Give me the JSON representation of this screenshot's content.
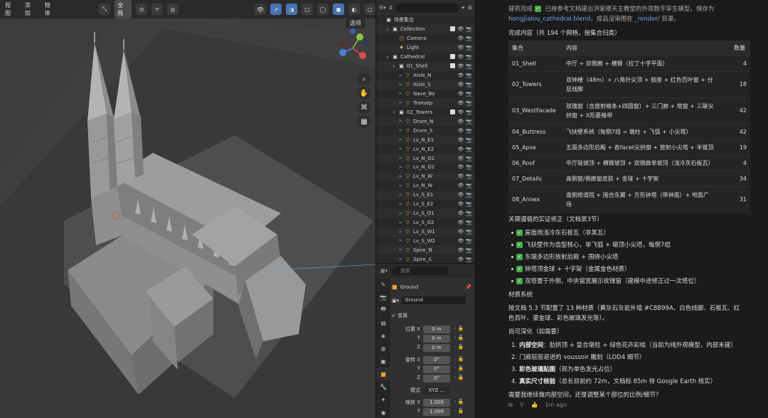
{
  "viewport": {
    "menu": [
      "视图",
      "添加",
      "物体"
    ],
    "transform_orientation": "全局",
    "selector_label": "选项"
  },
  "outliner": {
    "search_placeholder": "",
    "rows": [
      {
        "label": "场景集合",
        "indent": 0,
        "icon": "collection",
        "expand": "",
        "sel": false
      },
      {
        "label": "Collection",
        "indent": 1,
        "icon": "collection",
        "expand": "v",
        "sel": false
      },
      {
        "label": "Camera",
        "indent": 2,
        "icon": "camera",
        "expand": "",
        "sel": false
      },
      {
        "label": "Light",
        "indent": 2,
        "icon": "light",
        "expand": "",
        "sel": false
      },
      {
        "label": "Cathedral",
        "indent": 1,
        "icon": "collection",
        "expand": "v",
        "sel": false
      },
      {
        "label": "01_Shell",
        "indent": 2,
        "icon": "collection",
        "expand": "v",
        "sel": false
      },
      {
        "label": "Aisle_N",
        "indent": 3,
        "icon": "mesh",
        "expand": ">",
        "sel": false
      },
      {
        "label": "Aisle_S",
        "indent": 3,
        "icon": "mesh",
        "expand": ">",
        "sel": false
      },
      {
        "label": "Nave_Bo",
        "indent": 3,
        "icon": "mesh",
        "expand": ">",
        "sel": false
      },
      {
        "label": "Transep",
        "indent": 3,
        "icon": "mesh",
        "expand": ">",
        "sel": false
      },
      {
        "label": "02_Towers",
        "indent": 2,
        "icon": "collection",
        "expand": "v",
        "sel": false
      },
      {
        "label": "Drum_N",
        "indent": 3,
        "icon": "mesh",
        "expand": ">",
        "sel": false
      },
      {
        "label": "Drum_S",
        "indent": 3,
        "icon": "mesh",
        "expand": ">",
        "sel": false
      },
      {
        "label": "Lv_N_E1",
        "indent": 3,
        "icon": "mesh",
        "expand": ">",
        "sel": false
      },
      {
        "label": "Lv_N_E2",
        "indent": 3,
        "icon": "mesh",
        "expand": ">",
        "sel": false
      },
      {
        "label": "Lv_N_O1",
        "indent": 3,
        "icon": "mesh",
        "expand": ">",
        "sel": false
      },
      {
        "label": "Lv_N_O2",
        "indent": 3,
        "icon": "mesh",
        "expand": ">",
        "sel": false
      },
      {
        "label": "Lv_N_W",
        "indent": 3,
        "icon": "mesh",
        "expand": ">",
        "sel": false
      },
      {
        "label": "Lv_N_W",
        "indent": 3,
        "icon": "mesh",
        "expand": ">",
        "sel": false
      },
      {
        "label": "Lv_S_E1",
        "indent": 3,
        "icon": "mesh",
        "expand": ">",
        "sel": false
      },
      {
        "label": "Lv_S_E2",
        "indent": 3,
        "icon": "mesh",
        "expand": ">",
        "sel": false
      },
      {
        "label": "Lv_S_O1",
        "indent": 3,
        "icon": "mesh",
        "expand": ">",
        "sel": false
      },
      {
        "label": "Lv_S_O2",
        "indent": 3,
        "icon": "mesh",
        "expand": ">",
        "sel": false
      },
      {
        "label": "Lv_S_W1",
        "indent": 3,
        "icon": "mesh",
        "expand": ">",
        "sel": false
      },
      {
        "label": "Lv_S_W2",
        "indent": 3,
        "icon": "mesh",
        "expand": ">",
        "sel": false
      },
      {
        "label": "Spire_N",
        "indent": 3,
        "icon": "mesh",
        "expand": ">",
        "sel": false
      },
      {
        "label": "Spire_S",
        "indent": 3,
        "icon": "mesh",
        "expand": ">",
        "sel": false
      }
    ]
  },
  "properties": {
    "search_placeholder": "搜索",
    "object_name": "Ground",
    "mesh_name": "Ground",
    "section": "变换",
    "location_label": "位置 X",
    "location": {
      "x": "0 m",
      "y": "0 m",
      "z": "0 m"
    },
    "rotation_label": "旋转 X",
    "rotation": {
      "x": "0°",
      "y": "0°",
      "z": "0°"
    },
    "mode_label": "模式",
    "mode": "XYZ ...",
    "scale_label": "缩放 X",
    "scale": {
      "x": "1.000",
      "y": "1.000"
    },
    "axis": {
      "y": "Y",
      "z": "Z"
    }
  },
  "chat": {
    "intro_1": "建筑完成",
    "intro_2": "已按参考文档建出洪家楼天主教堂的外观数字孪生模型，保存为",
    "file": "hongjialou_cathedral.blend",
    "intro_3": "，成品渲染图在",
    "render_dir": "_render/",
    "intro_4": "目录。",
    "done_heading": "完成内容（共 194 个网格，按集合归类）",
    "table_headers": [
      "集合",
      "内容",
      "数量"
    ],
    "table_rows": [
      {
        "col": "01_Shell",
        "content": [
          "中厅 + 双侧廊 + 横臂（拉丁十字平面）"
        ],
        "count": "4"
      },
      {
        "col": "02_Towers",
        "content": [
          "双钟楼（48m）+ 八角针尖顶 + 鼓座 + 红色百叶窗 + 分",
          "层线脚"
        ],
        "count": "18"
      },
      {
        "col": "03_WestFacade",
        "content": [
          "玫瑰窗（含放射格条+四圆窗）+ 三门廊 + 塔窗 + 三联尖",
          "拱窗 + X形菱格带"
        ],
        "count": "42"
      },
      {
        "col": "04_Buttress",
        "content": [
          "飞扶壁系统（每侧7组 = 墩柱 + 飞弧 + 小尖塔）"
        ],
        "count": "42"
      },
      {
        "col": "05_Apse",
        "content": [
          "五面多边形后殿 + 各facet尖拱窗 + 放射小尖塔 + 半锥顶"
        ],
        "count": "19"
      },
      {
        "col": "06_Roof",
        "content": [
          "中厅陡坡顶 + 横臂坡顶 + 双侧廊单坡顶（浅冷灰石板瓦）"
        ],
        "count": "4"
      },
      {
        "col": "07_Details",
        "content": [
          "高侧窗/侧廊窗皮肤 + 金球 + 十字架"
        ],
        "count": "34"
      },
      {
        "col": "08_Annex",
        "content": [
          "南侧修道院 + 围合东翼 + 方形钟塔（带钟面）+ 地面广",
          "场"
        ],
        "count": "31"
      }
    ],
    "fixes_heading": "关键遵循的实证修正（文档第3节）",
    "fixes": [
      "屋面用浅冷灰石板瓦（非黑瓦）",
      "飞扶壁作为造型核心，单飞弧 + 墩顶小尖塔，每侧7组",
      "东端多边形放射后殿 + 围绕小尖塔",
      "钟塔顶金球 + 十字架（金属金色材质）",
      "双塔置于外侧、中央留宽展示玫瑰窗（建模中途修正过一次塔位）"
    ],
    "materials_heading": "材质系统",
    "materials_1": "按文档 5.3 节配置了 13 种材质（黄灰石灰岩外墙 #C8B99A、白色线脚、石板瓦、红",
    "materials_2": "色百叶、鎏金球、彩色玻璃发光等）。",
    "deepen_heading": "尚可深化（如需要）",
    "deepen": [
      {
        "num": "1.",
        "bold": "内部空间",
        "rest": "：肋拱顶 + 复合墩柱 + 绿色花卉彩绘（当前为纯外观模型，内部未建）"
      },
      {
        "num": "2.",
        "bold": "",
        "rest": "门廊层层退进的 voussoir 雕刻（LOD4 细节）"
      },
      {
        "num": "3.",
        "bold": "彩色玻璃贴图",
        "rest": "（现为单色发光占位）"
      },
      {
        "num": "4.",
        "bold": "真实尺寸核验",
        "rest": "（总长目前约 72m，文档标 85m 待 Google Earth 核实）"
      }
    ],
    "question": "需要我继续做内部空间，还是调整某个部位的比例/细节？",
    "time": "1m ago"
  }
}
